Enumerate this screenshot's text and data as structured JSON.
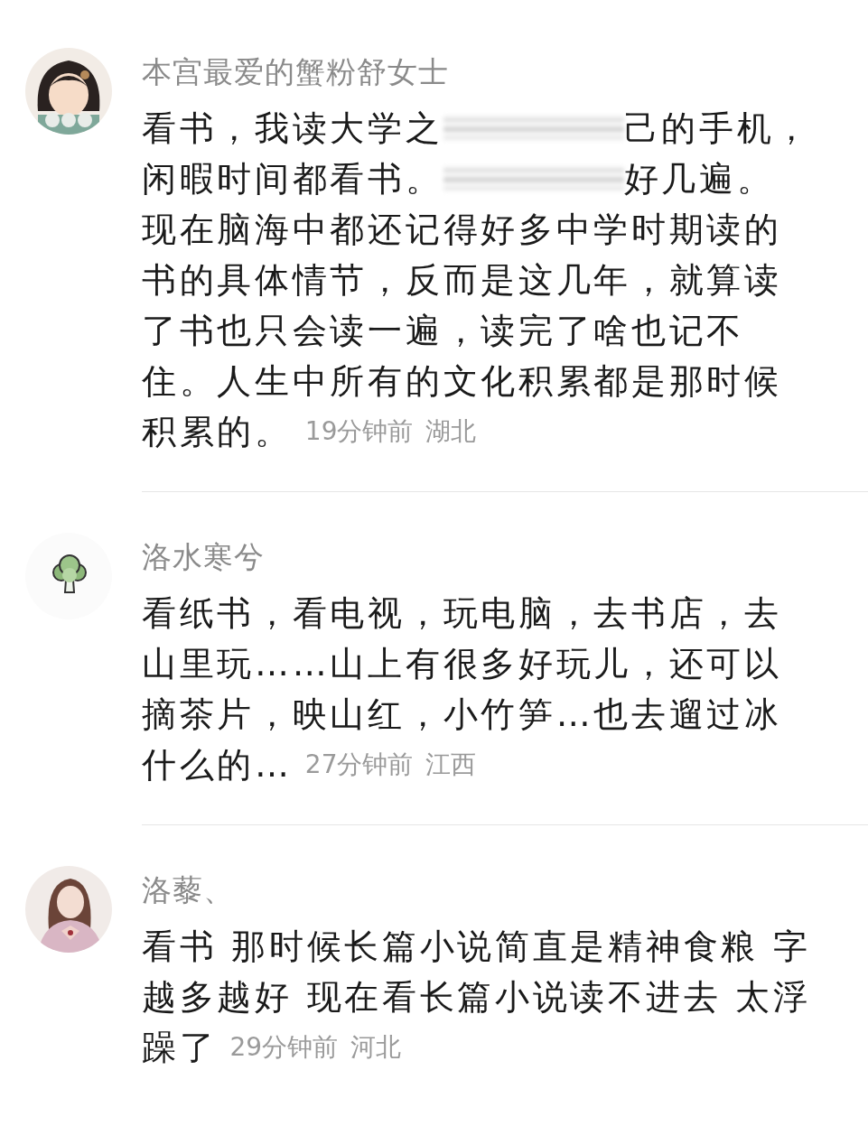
{
  "comments": [
    {
      "avatar": {
        "kind": "girl"
      },
      "name": "本宫最爱的蟹粉舒女士",
      "lines": [
        [
          {
            "kind": "text",
            "text": "看书，我读大学之"
          },
          {
            "kind": "blur"
          },
          {
            "kind": "text",
            "text": "己的手机，"
          }
        ],
        [
          {
            "kind": "text",
            "text": "闲暇时间都看书。"
          },
          {
            "kind": "blur"
          },
          {
            "kind": "text",
            "text": "好几遍。"
          }
        ],
        [
          {
            "kind": "text",
            "text": "现在脑海中都还记得好多中学时期读的"
          }
        ],
        [
          {
            "kind": "text",
            "text": "书的具体情节，反而是这几年，就算读"
          }
        ],
        [
          {
            "kind": "text",
            "text": "了书也只会读一遍，读完了啥也记不"
          }
        ],
        [
          {
            "kind": "text",
            "text": "住。人生中所有的文化积累都是那时候"
          }
        ],
        [
          {
            "kind": "text",
            "text": "积累的。"
          }
        ]
      ],
      "time": "19分钟前",
      "location": "湖北"
    },
    {
      "avatar": {
        "kind": "broccoli"
      },
      "name": "洛水寒兮",
      "lines": [
        [
          {
            "kind": "text",
            "text": "看纸书，看电视，玩电脑，去书店，去"
          }
        ],
        [
          {
            "kind": "text",
            "text": "山里玩……山上有很多好玩儿，还可以"
          }
        ],
        [
          {
            "kind": "text",
            "text": "摘茶片，映山红，小竹笋…也去遛过冰"
          }
        ],
        [
          {
            "kind": "text",
            "text": "什么的…"
          }
        ]
      ],
      "time": "27分钟前",
      "location": "江西"
    },
    {
      "avatar": {
        "kind": "woman"
      },
      "name": "洛藜、",
      "lines": [
        [
          {
            "kind": "text",
            "text": "看书 那时候长篇小说简直是精神食粮 字"
          }
        ],
        [
          {
            "kind": "text",
            "text": "越多越好 现在看长篇小说读不进去 太浮"
          }
        ],
        [
          {
            "kind": "text",
            "text": "躁了"
          }
        ]
      ],
      "time": "29分钟前",
      "location": "河北"
    }
  ]
}
